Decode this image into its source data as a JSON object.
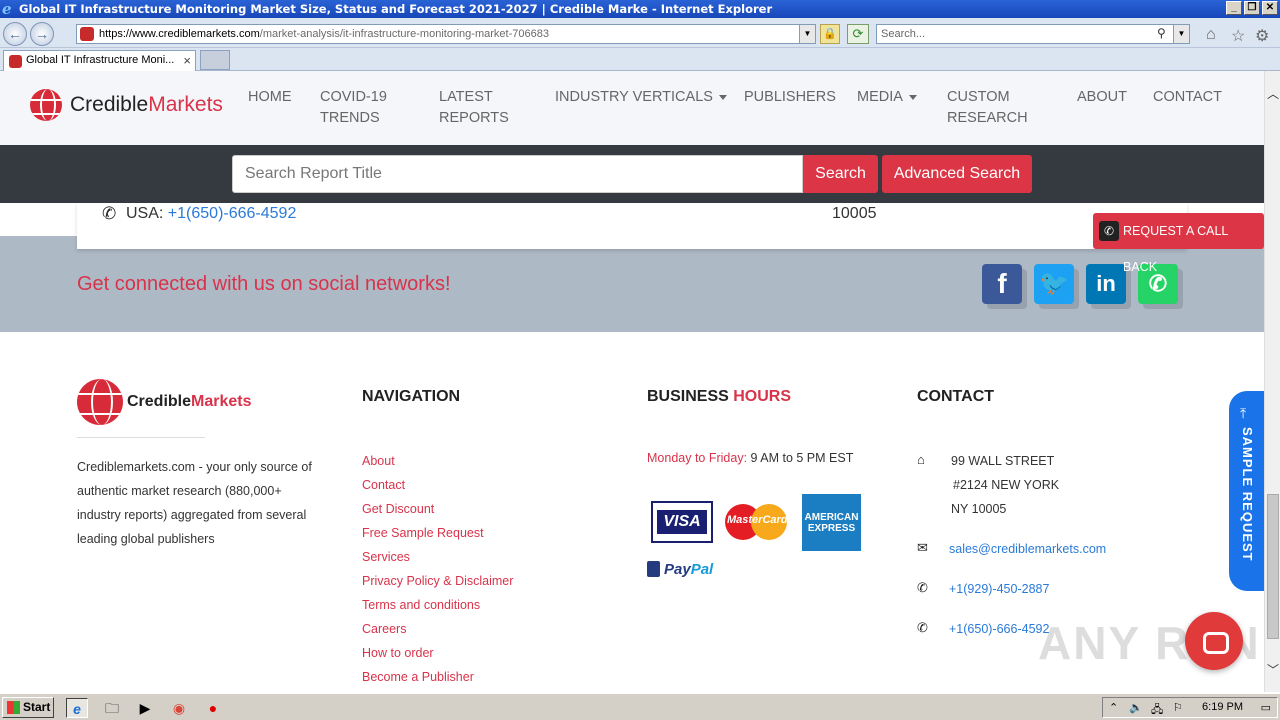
{
  "browser": {
    "window_title": "Global IT Infrastructure Monitoring Market Size, Status and Forecast 2021-2027 | Credible Marke - Internet Explorer",
    "url_host": "https://www.crediblemarkets.com",
    "url_path": "/market-analysis/it-infrastructure-monitoring-market-706683",
    "search_placeholder": "Search...",
    "tab_label": "Global IT Infrastructure Moni...",
    "tab_close": "×"
  },
  "site": {
    "logo": {
      "part1": "Credible",
      "part2": "Markets"
    },
    "nav": [
      {
        "label": "HOME"
      },
      {
        "label": "COVID-19 TRENDS"
      },
      {
        "label": "LATEST REPORTS"
      },
      {
        "label": "INDUSTRY VERTICALS"
      },
      {
        "label": "PUBLISHERS"
      },
      {
        "label": "MEDIA"
      },
      {
        "label": "CUSTOM RESEARCH"
      },
      {
        "label": "ABOUT"
      },
      {
        "label": "CONTACT"
      }
    ],
    "search": {
      "placeholder": "Search Report Title",
      "search_label": "Search",
      "advanced_label": "Advanced Search"
    },
    "card": {
      "usa_label": "USA: ",
      "usa_phone": "+1(650)-666-4592",
      "zip": "10005"
    },
    "call_back_label": "REQUEST A CALL BACK",
    "social": {
      "title": "Get connected with us on social networks!",
      "icons": [
        "facebook-icon",
        "twitter-icon",
        "linkedin-icon",
        "whatsapp-icon"
      ]
    },
    "footer": {
      "about_text": "Crediblemarkets.com - your only source of authentic market research (880,000+ industry reports) aggregated from several leading global publishers",
      "nav_heading": "NAVIGATION",
      "nav_links": [
        "About",
        "Contact",
        "Get Discount",
        "Free Sample Request",
        "Services",
        "Privacy Policy & Disclaimer",
        "Terms and conditions",
        "Careers",
        "How to order",
        "Become a Publisher"
      ],
      "hours_heading_1": "BUSINESS ",
      "hours_heading_2": "HOURS",
      "hours_label": "Monday to Friday:",
      "hours_value": " 9 AM to 5 PM EST",
      "payments": {
        "visa": "VISA",
        "mastercard": "MasterCard",
        "amex": "AMERICAN EXPRESS",
        "paypal_1": "Pay",
        "paypal_2": "Pal"
      },
      "contact_heading": "CONTACT",
      "address_1": "99 WALL STREET",
      "address_2": "#2124 NEW YORK",
      "address_3": "NY 10005",
      "email": "sales@crediblemarkets.com",
      "phone_1": "+1(929)-450-2887",
      "phone_2": "+1(650)-666-4592"
    },
    "sample_request_label": "SAMPLE REQUEST",
    "watermark": "ANY RUN"
  },
  "taskbar": {
    "start_label": "Start",
    "clock": "6:19 PM"
  },
  "colors": {
    "accent_red": "#d8334a",
    "button_red": "#dc3545",
    "link_blue": "#2a7ad9",
    "dark_band": "#343a40"
  }
}
